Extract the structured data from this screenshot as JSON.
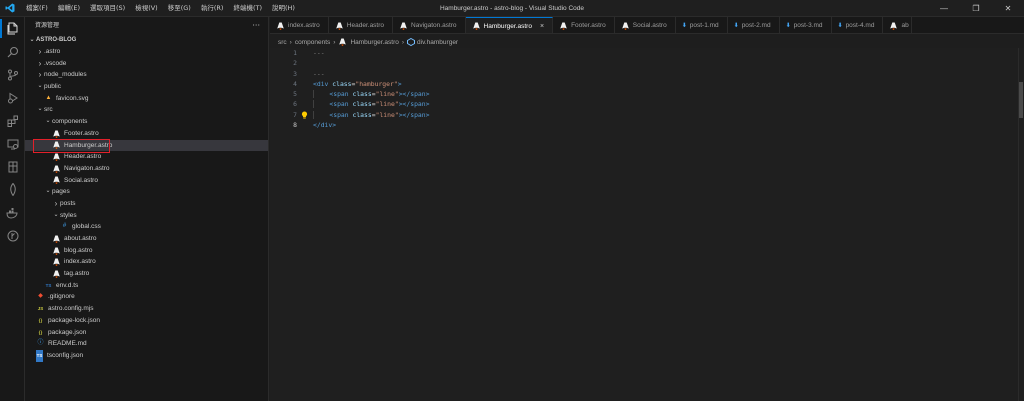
{
  "window": {
    "title": "Hamburger.astro - astro-blog - Visual Studio Code",
    "menus": [
      "檔案(F)",
      "編輯(E)",
      "選取項目(S)",
      "檢視(V)",
      "移至(G)",
      "執行(R)",
      "終端機(T)",
      "說明(H)"
    ]
  },
  "sidebar": {
    "header": "資源管理",
    "project": "ASTRO-BLOG",
    "tree": [
      {
        "label": ".astro",
        "type": "folder",
        "open": false,
        "depth": 1
      },
      {
        "label": ".vscode",
        "type": "folder",
        "open": false,
        "depth": 1
      },
      {
        "label": "node_modules",
        "type": "folder",
        "open": false,
        "depth": 1
      },
      {
        "label": "public",
        "type": "folder",
        "open": true,
        "depth": 1
      },
      {
        "label": "favicon.svg",
        "type": "svg",
        "depth": 2
      },
      {
        "label": "src",
        "type": "folder",
        "open": true,
        "depth": 1
      },
      {
        "label": "components",
        "type": "folder",
        "open": true,
        "depth": 2
      },
      {
        "label": "Footer.astro",
        "type": "astro",
        "depth": 3
      },
      {
        "label": "Hamburger.astro",
        "type": "astro",
        "depth": 3,
        "selected": true
      },
      {
        "label": "Header.astro",
        "type": "astro",
        "depth": 3
      },
      {
        "label": "Navigaton.astro",
        "type": "astro",
        "depth": 3
      },
      {
        "label": "Social.astro",
        "type": "astro",
        "depth": 3
      },
      {
        "label": "pages",
        "type": "folder",
        "open": true,
        "depth": 2
      },
      {
        "label": "posts",
        "type": "folder",
        "open": false,
        "depth": 3
      },
      {
        "label": "styles",
        "type": "folder",
        "open": true,
        "depth": 3
      },
      {
        "label": "global.css",
        "type": "css",
        "depth": 4
      },
      {
        "label": "about.astro",
        "type": "astro",
        "depth": 3
      },
      {
        "label": "blog.astro",
        "type": "astro",
        "depth": 3
      },
      {
        "label": "index.astro",
        "type": "astro",
        "depth": 3
      },
      {
        "label": "tag.astro",
        "type": "astro",
        "depth": 3
      },
      {
        "label": "env.d.ts",
        "type": "ts",
        "depth": 2
      },
      {
        "label": ".gitignore",
        "type": "git",
        "depth": 1
      },
      {
        "label": "astro.config.mjs",
        "type": "js",
        "depth": 1
      },
      {
        "label": "package-lock.json",
        "type": "json",
        "depth": 1
      },
      {
        "label": "package.json",
        "type": "json",
        "depth": 1
      },
      {
        "label": "README.md",
        "type": "info",
        "depth": 1
      },
      {
        "label": "tsconfig.json",
        "type": "tsconfig",
        "depth": 1
      }
    ]
  },
  "tabs": [
    {
      "label": "index.astro",
      "type": "astro"
    },
    {
      "label": "Header.astro",
      "type": "astro"
    },
    {
      "label": "Navigaton.astro",
      "type": "astro"
    },
    {
      "label": "Hamburger.astro",
      "type": "astro",
      "active": true
    },
    {
      "label": "Footer.astro",
      "type": "astro"
    },
    {
      "label": "Social.astro",
      "type": "astro"
    },
    {
      "label": "post-1.md",
      "type": "md"
    },
    {
      "label": "post-2.md",
      "type": "md"
    },
    {
      "label": "post-3.md",
      "type": "md"
    },
    {
      "label": "post-4.md",
      "type": "md"
    },
    {
      "label": "ab",
      "type": "astro"
    }
  ],
  "breadcrumb": [
    "src",
    "components",
    "Hamburger.astro",
    "div.hamburger"
  ],
  "editor": {
    "line_numbers": [
      "1",
      "2",
      "3",
      "4",
      "5",
      "6",
      "7",
      "8"
    ],
    "current_line": "8",
    "lines": [
      [
        {
          "t": "---",
          "c": "c-gray"
        }
      ],
      [],
      [
        {
          "t": "---",
          "c": "c-gray"
        }
      ],
      [
        {
          "t": "<div ",
          "c": "c-tag"
        },
        {
          "t": "class",
          "c": "c-attr"
        },
        {
          "t": "=",
          "c": "c-eq"
        },
        {
          "t": "\"hamburger\"",
          "c": "c-str"
        },
        {
          "t": ">",
          "c": "c-tag"
        }
      ],
      [
        {
          "t": "    ",
          "c": ""
        },
        {
          "t": "<span ",
          "c": "c-tag"
        },
        {
          "t": "class",
          "c": "c-attr"
        },
        {
          "t": "=",
          "c": "c-eq"
        },
        {
          "t": "\"line\"",
          "c": "c-str"
        },
        {
          "t": "></span>",
          "c": "c-tag"
        }
      ],
      [
        {
          "t": "    ",
          "c": ""
        },
        {
          "t": "<span ",
          "c": "c-tag"
        },
        {
          "t": "class",
          "c": "c-attr"
        },
        {
          "t": "=",
          "c": "c-eq"
        },
        {
          "t": "\"line\"",
          "c": "c-str"
        },
        {
          "t": "></span>",
          "c": "c-tag"
        }
      ],
      [
        {
          "t": "    ",
          "c": ""
        },
        {
          "t": "<span ",
          "c": "c-tag"
        },
        {
          "t": "class",
          "c": "c-attr"
        },
        {
          "t": "=",
          "c": "c-eq"
        },
        {
          "t": "\"line\"",
          "c": "c-str"
        },
        {
          "t": "></span>",
          "c": "c-tag"
        }
      ],
      [
        {
          "t": "</div>",
          "c": "c-tag"
        }
      ]
    ]
  },
  "colors": {
    "accent": "#0078d4",
    "highlight_box": "#e2202a"
  }
}
